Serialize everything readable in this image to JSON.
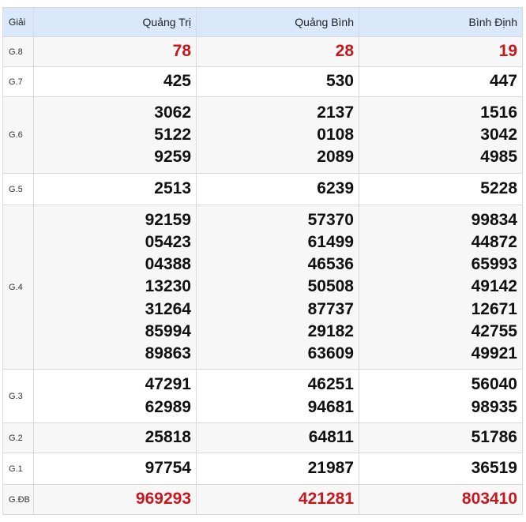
{
  "header": {
    "label": "Giải",
    "provinces": [
      "Quảng Trị",
      "Quảng Bình",
      "Bình Định"
    ]
  },
  "rows": [
    {
      "label": "G.8",
      "values": [
        [
          "78"
        ],
        [
          "28"
        ],
        [
          "19"
        ]
      ],
      "highlight": true
    },
    {
      "label": "G.7",
      "values": [
        [
          "425"
        ],
        [
          "530"
        ],
        [
          "447"
        ]
      ]
    },
    {
      "label": "G.6",
      "values": [
        [
          "3062",
          "5122",
          "9259"
        ],
        [
          "2137",
          "0108",
          "2089"
        ],
        [
          "1516",
          "3042",
          "4985"
        ]
      ]
    },
    {
      "label": "G.5",
      "values": [
        [
          "2513"
        ],
        [
          "6239"
        ],
        [
          "5228"
        ]
      ]
    },
    {
      "label": "G.4",
      "values": [
        [
          "92159",
          "05423",
          "04388",
          "13230",
          "31264",
          "85994",
          "89863"
        ],
        [
          "57370",
          "61499",
          "46536",
          "50508",
          "87737",
          "29182",
          "63609"
        ],
        [
          "99834",
          "44872",
          "65993",
          "49142",
          "12671",
          "42755",
          "49921"
        ]
      ]
    },
    {
      "label": "G.3",
      "values": [
        [
          "47291",
          "62989"
        ],
        [
          "46251",
          "94681"
        ],
        [
          "56040",
          "98935"
        ]
      ]
    },
    {
      "label": "G.2",
      "values": [
        [
          "25818"
        ],
        [
          "64811"
        ],
        [
          "51786"
        ]
      ]
    },
    {
      "label": "G.1",
      "values": [
        [
          "97754"
        ],
        [
          "21987"
        ],
        [
          "36519"
        ]
      ]
    },
    {
      "label": "G.ĐB",
      "values": [
        [
          "969293"
        ],
        [
          "421281"
        ],
        [
          "803410"
        ]
      ],
      "highlight": true
    }
  ],
  "colors": {
    "header_bg": "#d9e8fb",
    "highlight": "#c8161d",
    "stripe": "#f7f7f7"
  }
}
